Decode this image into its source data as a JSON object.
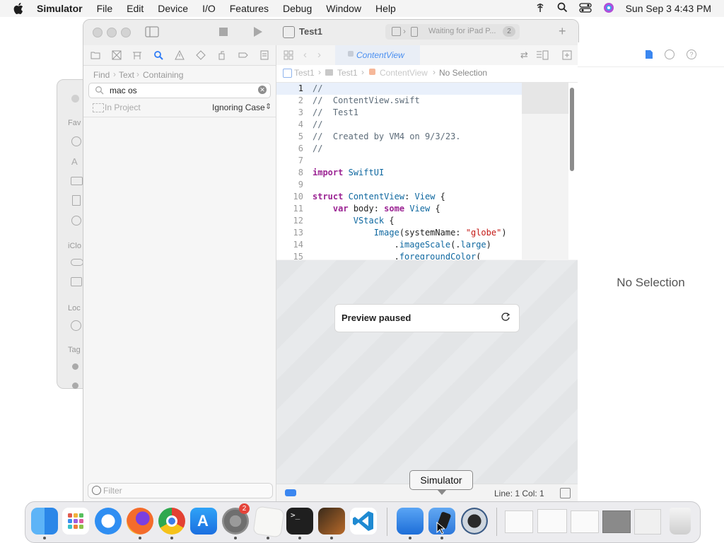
{
  "menubar": {
    "app_name": "Simulator",
    "items": [
      "File",
      "Edit",
      "Device",
      "I/O",
      "Features",
      "Debug",
      "Window",
      "Help"
    ],
    "clock": "Sun Sep 3  4:43 PM"
  },
  "xcode": {
    "scheme": "Test1",
    "run_destination_status": "Waiting for iPad P...",
    "issue_count": "2",
    "editor_tab": "ContentView",
    "find": {
      "breadcrumb": [
        "Find",
        "Text",
        "Containing"
      ],
      "query": "mac os",
      "scope": "In Project",
      "match_mode": "Ignoring Case"
    },
    "jumpbar": [
      "Test1",
      "Test1",
      "ContentView",
      "No Selection"
    ],
    "code_lines": [
      {
        "n": "1",
        "t": "//"
      },
      {
        "n": "2",
        "t": "//  ContentView.swift"
      },
      {
        "n": "3",
        "t": "//  Test1"
      },
      {
        "n": "4",
        "t": "//"
      },
      {
        "n": "5",
        "t": "//  Created by VM4 on 9/3/23."
      },
      {
        "n": "6",
        "t": "//"
      },
      {
        "n": "7",
        "t": ""
      },
      {
        "n": "8",
        "t": "import SwiftUI"
      },
      {
        "n": "9",
        "t": ""
      },
      {
        "n": "10",
        "t": "struct ContentView: View {"
      },
      {
        "n": "11",
        "t": "    var body: some View {"
      },
      {
        "n": "12",
        "t": "        VStack {"
      },
      {
        "n": "13",
        "t": "            Image(systemName: \"globe\")"
      },
      {
        "n": "14",
        "t": "                .imageScale(.large)"
      },
      {
        "n": "15",
        "t": "                .foregroundColor("
      }
    ],
    "preview_status": "Preview paused",
    "filter_placeholder": "Filter",
    "cursor_position": "Line: 1  Col: 1",
    "inspector_empty": "No Selection"
  },
  "tooltip": "Simulator",
  "dock": {
    "items": [
      "finder-icon",
      "launchpad-icon",
      "safari-icon",
      "firefox-icon",
      "chrome-icon",
      "app-store-icon",
      "system-settings-icon",
      "textedit-icon",
      "terminal-icon",
      "instruments-icon",
      "vscode-icon",
      "xcode-icon",
      "simulator-icon",
      "quicktime-icon",
      "minimized-window-icons",
      "trash-icon"
    ],
    "system_settings_badge": "2"
  }
}
